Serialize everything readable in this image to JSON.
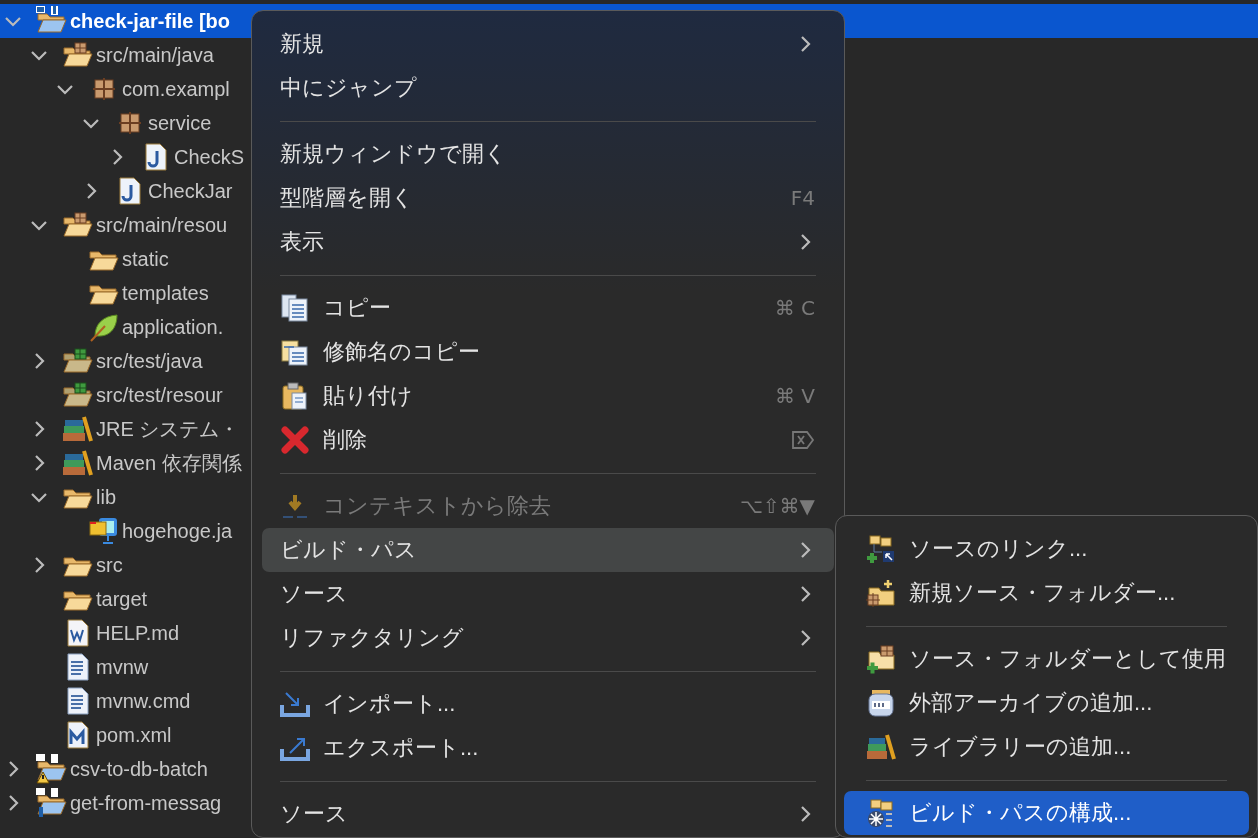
{
  "tree": [
    {
      "label": "check-jar-file [bo",
      "kind": "project",
      "expanded": true,
      "selected": true,
      "children": [
        {
          "label": "src/main/java",
          "kind": "src-folder",
          "expanded": true,
          "selected": false,
          "children": [
            {
              "label": "com.exampl",
              "kind": "package",
              "expanded": true,
              "selected": false,
              "children": [
                {
                  "label": "service",
                  "kind": "package",
                  "expanded": true,
                  "selected": false,
                  "children": [
                    {
                      "label": "CheckS",
                      "kind": "java",
                      "expanded": false,
                      "selected": false
                    }
                  ]
                },
                {
                  "label": "CheckJar",
                  "kind": "java",
                  "expanded": false,
                  "selected": false
                }
              ]
            }
          ]
        },
        {
          "label": "src/main/resou",
          "kind": "src-folder",
          "expanded": true,
          "selected": false,
          "children": [
            {
              "label": "static",
              "kind": "folder",
              "selected": false
            },
            {
              "label": "templates",
              "kind": "folder",
              "selected": false
            },
            {
              "label": "application.",
              "kind": "leaf",
              "selected": false
            }
          ]
        },
        {
          "label": "src/test/java",
          "kind": "test-folder",
          "expanded": false,
          "selected": false
        },
        {
          "label": "src/test/resour",
          "kind": "test-folder",
          "selected": false
        },
        {
          "label": "JRE システム・",
          "kind": "library",
          "expanded": false,
          "selected": false
        },
        {
          "label": "Maven 依存関係",
          "kind": "library",
          "expanded": false,
          "selected": false
        },
        {
          "label": "lib",
          "kind": "folder",
          "expanded": true,
          "selected": false,
          "children": [
            {
              "label": "hogehoge.ja",
              "kind": "jar",
              "selected": false
            }
          ]
        },
        {
          "label": "src",
          "kind": "folder",
          "expanded": false,
          "selected": false
        },
        {
          "label": "target",
          "kind": "folder",
          "selected": false
        },
        {
          "label": "HELP.md",
          "kind": "word-doc",
          "selected": false
        },
        {
          "label": "mvnw",
          "kind": "text-doc",
          "selected": false
        },
        {
          "label": "mvnw.cmd",
          "kind": "text-doc",
          "selected": false
        },
        {
          "label": "pom.xml",
          "kind": "maven-doc",
          "selected": false
        }
      ]
    },
    {
      "label": "csv-to-db-batch",
      "kind": "project-warning",
      "expanded": false,
      "selected": false
    },
    {
      "label": "get-from-messag",
      "kind": "project-info",
      "expanded": false,
      "selected": false
    }
  ],
  "context_menu": {
    "items": [
      {
        "kind": "item",
        "label": "新規",
        "has_submenu": true,
        "selected": false,
        "disabled": false
      },
      {
        "kind": "item",
        "label": "中にジャンプ",
        "has_submenu": false,
        "selected": false,
        "disabled": false
      },
      {
        "kind": "separator"
      },
      {
        "kind": "item",
        "label": "新規ウィンドウで開く",
        "has_submenu": false,
        "selected": false,
        "disabled": false
      },
      {
        "kind": "item",
        "label": "型階層を開く",
        "shortcut": "F4",
        "has_submenu": false,
        "selected": false,
        "disabled": false
      },
      {
        "kind": "item",
        "label": "表示",
        "has_submenu": true,
        "selected": false,
        "disabled": false
      },
      {
        "kind": "separator"
      },
      {
        "kind": "item",
        "label": "コピー",
        "shortcut": "⌘ C",
        "has_submenu": false,
        "selected": false,
        "disabled": false
      },
      {
        "kind": "item",
        "label": "修飾名のコピー",
        "has_submenu": false,
        "selected": false,
        "disabled": false
      },
      {
        "kind": "item",
        "label": "貼り付け",
        "shortcut": "⌘ V",
        "has_submenu": false,
        "selected": false,
        "disabled": false
      },
      {
        "kind": "item",
        "label": "削除",
        "has_submenu": false,
        "selected": false,
        "disabled": false
      },
      {
        "kind": "separator"
      },
      {
        "kind": "item",
        "label": "コンテキストから除去",
        "shortcut": "⌥⇧⌘▼",
        "has_submenu": false,
        "selected": false,
        "disabled": true
      },
      {
        "kind": "item",
        "label": "ビルド・パス",
        "has_submenu": true,
        "selected": true,
        "disabled": false
      },
      {
        "kind": "item",
        "label": "ソース",
        "has_submenu": true,
        "selected": false,
        "disabled": false
      },
      {
        "kind": "item",
        "label": "リファクタリング",
        "has_submenu": true,
        "selected": false,
        "disabled": false
      },
      {
        "kind": "separator"
      },
      {
        "kind": "item",
        "label": "インポート...",
        "has_submenu": false,
        "selected": false,
        "disabled": false
      },
      {
        "kind": "item",
        "label": "エクスポート...",
        "has_submenu": false,
        "selected": false,
        "disabled": false
      },
      {
        "kind": "separator"
      },
      {
        "kind": "item",
        "label": "ソース",
        "has_submenu": true,
        "selected": false,
        "disabled": false
      }
    ]
  },
  "submenu": {
    "items": [
      {
        "kind": "item",
        "label": "ソースのリンク...",
        "selected": false
      },
      {
        "kind": "item",
        "label": "新規ソース・フォルダー...",
        "selected": false
      },
      {
        "kind": "separator"
      },
      {
        "kind": "item",
        "label": "ソース・フォルダーとして使用",
        "selected": false
      },
      {
        "kind": "item",
        "label": "外部アーカイブの追加...",
        "selected": false
      },
      {
        "kind": "item",
        "label": "ライブラリーの追加...",
        "selected": false
      },
      {
        "kind": "separator"
      },
      {
        "kind": "item",
        "label": "ビルド・パスの構成...",
        "selected": true
      }
    ]
  }
}
